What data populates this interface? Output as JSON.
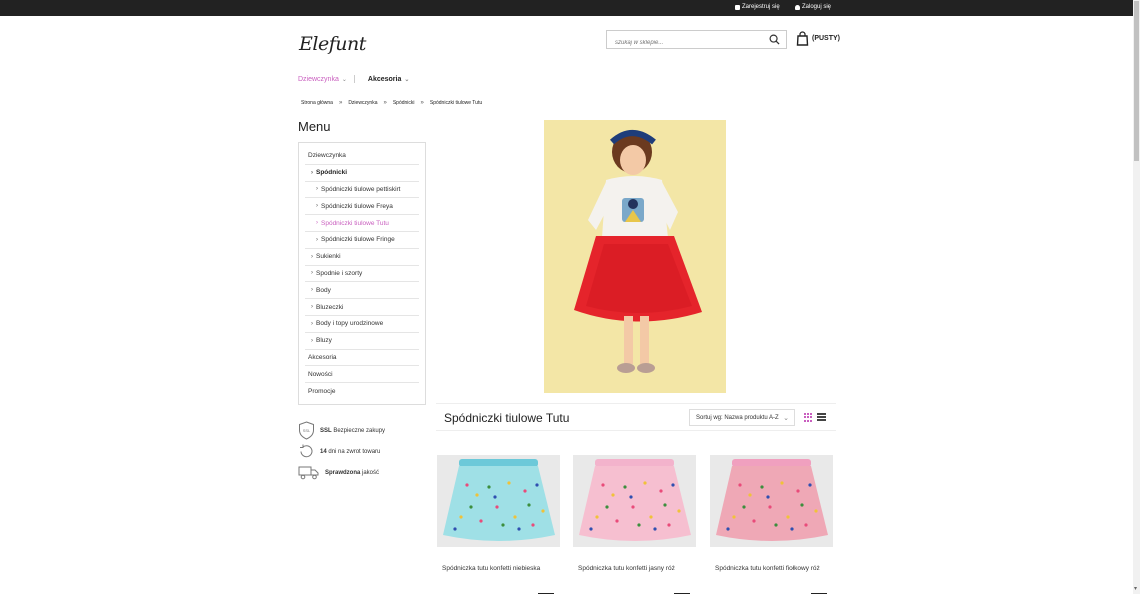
{
  "topbar": {
    "register": "Zarejestruj się",
    "login": "Zaloguj się"
  },
  "header": {
    "logo": "Elefunt",
    "search_placeholder": "szukaj w sklepie...",
    "cart_label": "(PUSTY)"
  },
  "nav": {
    "items": [
      {
        "label": "Dziewczynka",
        "active": true
      },
      {
        "label": "Akcesoria",
        "active": false
      }
    ]
  },
  "breadcrumb": [
    "Strona główna",
    "Dziewczynka",
    "Spódnicki",
    "Spódniczki tiulowe Tutu"
  ],
  "sidebar": {
    "title": "Menu",
    "items": [
      {
        "label": "Dziewczynka",
        "level": 0
      },
      {
        "label": "Spódnicki",
        "level": 1
      },
      {
        "label": "Spódniczki tiulowe pettiskirt",
        "level": 2
      },
      {
        "label": "Spódniczki tiulowe Freya",
        "level": 2
      },
      {
        "label": "Spódniczki tiulowe Tutu",
        "level": 2
      },
      {
        "label": "Spódniczki tiulowe Fringe",
        "level": 2
      },
      {
        "label": "Sukienki",
        "level": 1
      },
      {
        "label": "Spodnie i szorty",
        "level": 1
      },
      {
        "label": "Body",
        "level": 1
      },
      {
        "label": "Bluzeczki",
        "level": 1
      },
      {
        "label": "Body i topy urodzinowe",
        "level": 1
      },
      {
        "label": "Bluzy",
        "level": 1
      },
      {
        "label": "Akcesoria",
        "level": 0
      },
      {
        "label": "Nowości",
        "level": 0
      },
      {
        "label": "Promocje",
        "level": 0
      }
    ]
  },
  "badges": [
    {
      "strong": "SSL",
      "text": "Bezpieczne zakupy"
    },
    {
      "strong": "14",
      "text": "dni na zwrot towaru"
    },
    {
      "strong": "Sprawdzona",
      "text": "jakość"
    }
  ],
  "category": {
    "title": "Spódniczki tiulowe Tutu",
    "sort_label": "Sortuj wg: Nazwa produktu A-Z"
  },
  "products": [
    {
      "name": "Spódniczka tutu konfetti niebieska",
      "color": "#9fe0e6",
      "band": "#6cc9d9"
    },
    {
      "name": "Spódniczka tutu konfetti jasny róż",
      "color": "#f6bfd0",
      "band": "#f3b3cc"
    },
    {
      "name": "Spódniczka tutu konfetti fiołkowy róż",
      "color": "#efa8b6",
      "band": "#f0a0bf"
    }
  ],
  "colors": {
    "accent": "#c95fbf",
    "topbar": "#222222"
  }
}
